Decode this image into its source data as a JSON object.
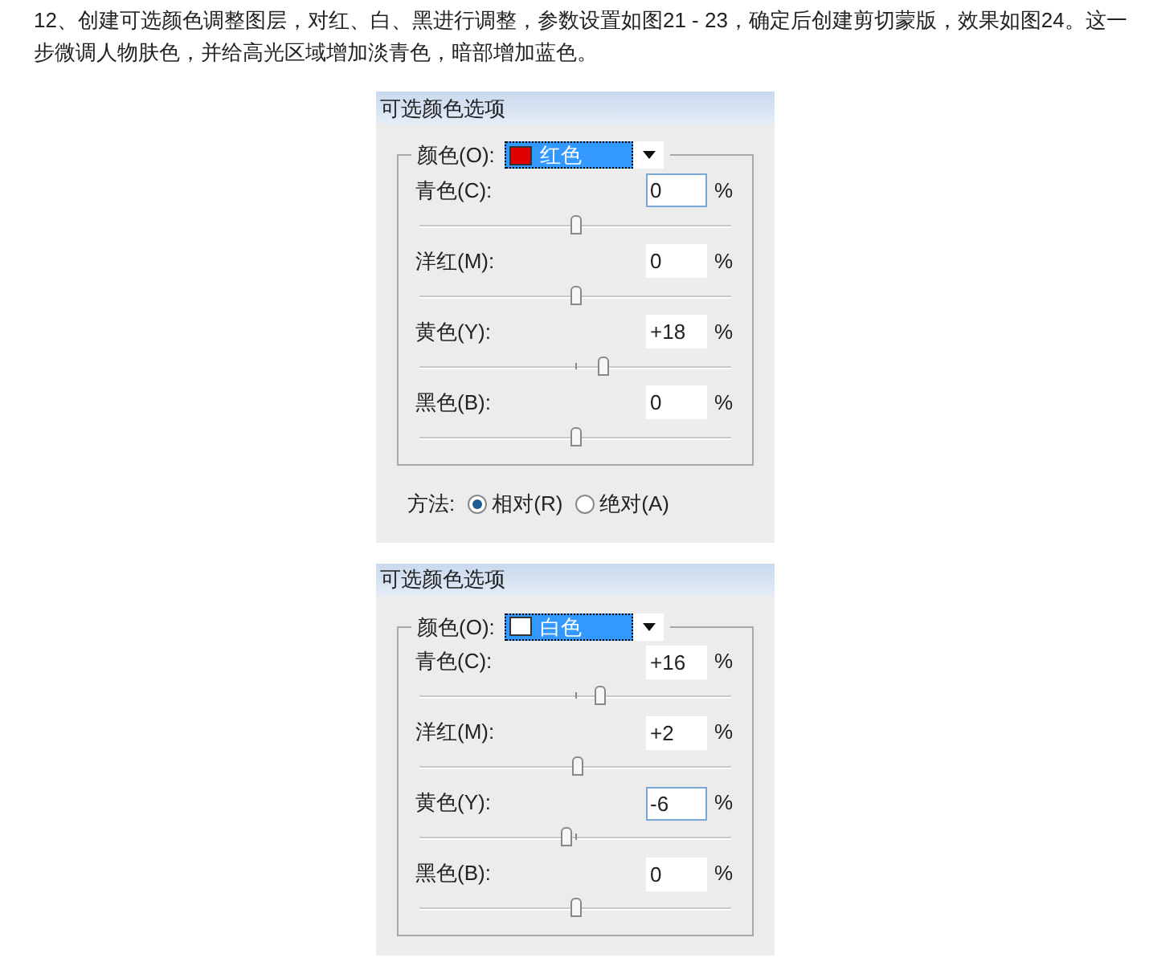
{
  "paragraph": "12、创建可选颜色调整图层，对红、白、黑进行调整，参数设置如图21 - 23，确定后创建剪切蒙版，效果如图24。这一步微调人物肤色，并给高光区域增加淡青色，暗部增加蓝色。",
  "dialogs": [
    {
      "title": "可选颜色选项",
      "color_label": "颜色(O):",
      "color_value": "红色",
      "color": "#e00000",
      "sliders": [
        {
          "label": "青色(C):",
          "value": "0",
          "unit": "%",
          "level": 0.5,
          "focused": true
        },
        {
          "label": "洋红(M):",
          "value": "0",
          "unit": "%",
          "level": 0.5,
          "focused": false
        },
        {
          "label": "黄色(Y):",
          "value": "+18",
          "unit": "%",
          "level": 0.59,
          "focused": false
        },
        {
          "label": "黑色(B):",
          "value": "0",
          "unit": "%",
          "level": 0.5,
          "focused": false
        }
      ],
      "method": {
        "label": "方法:",
        "options": [
          {
            "label": "相对(R)",
            "selected": true
          },
          {
            "label": "绝对(A)",
            "selected": false
          }
        ]
      }
    },
    {
      "title": "可选颜色选项",
      "color_label": "颜色(O):",
      "color_value": "白色",
      "color": "#ffffff",
      "sliders": [
        {
          "label": "青色(C):",
          "value": "+16",
          "unit": "%",
          "level": 0.58,
          "focused": false
        },
        {
          "label": "洋红(M):",
          "value": "+2",
          "unit": "%",
          "level": 0.51,
          "focused": false
        },
        {
          "label": "黄色(Y):",
          "value": "-6",
          "unit": "%",
          "level": 0.47,
          "focused": true
        },
        {
          "label": "黑色(B):",
          "value": "0",
          "unit": "%",
          "level": 0.5,
          "focused": false
        }
      ]
    }
  ]
}
